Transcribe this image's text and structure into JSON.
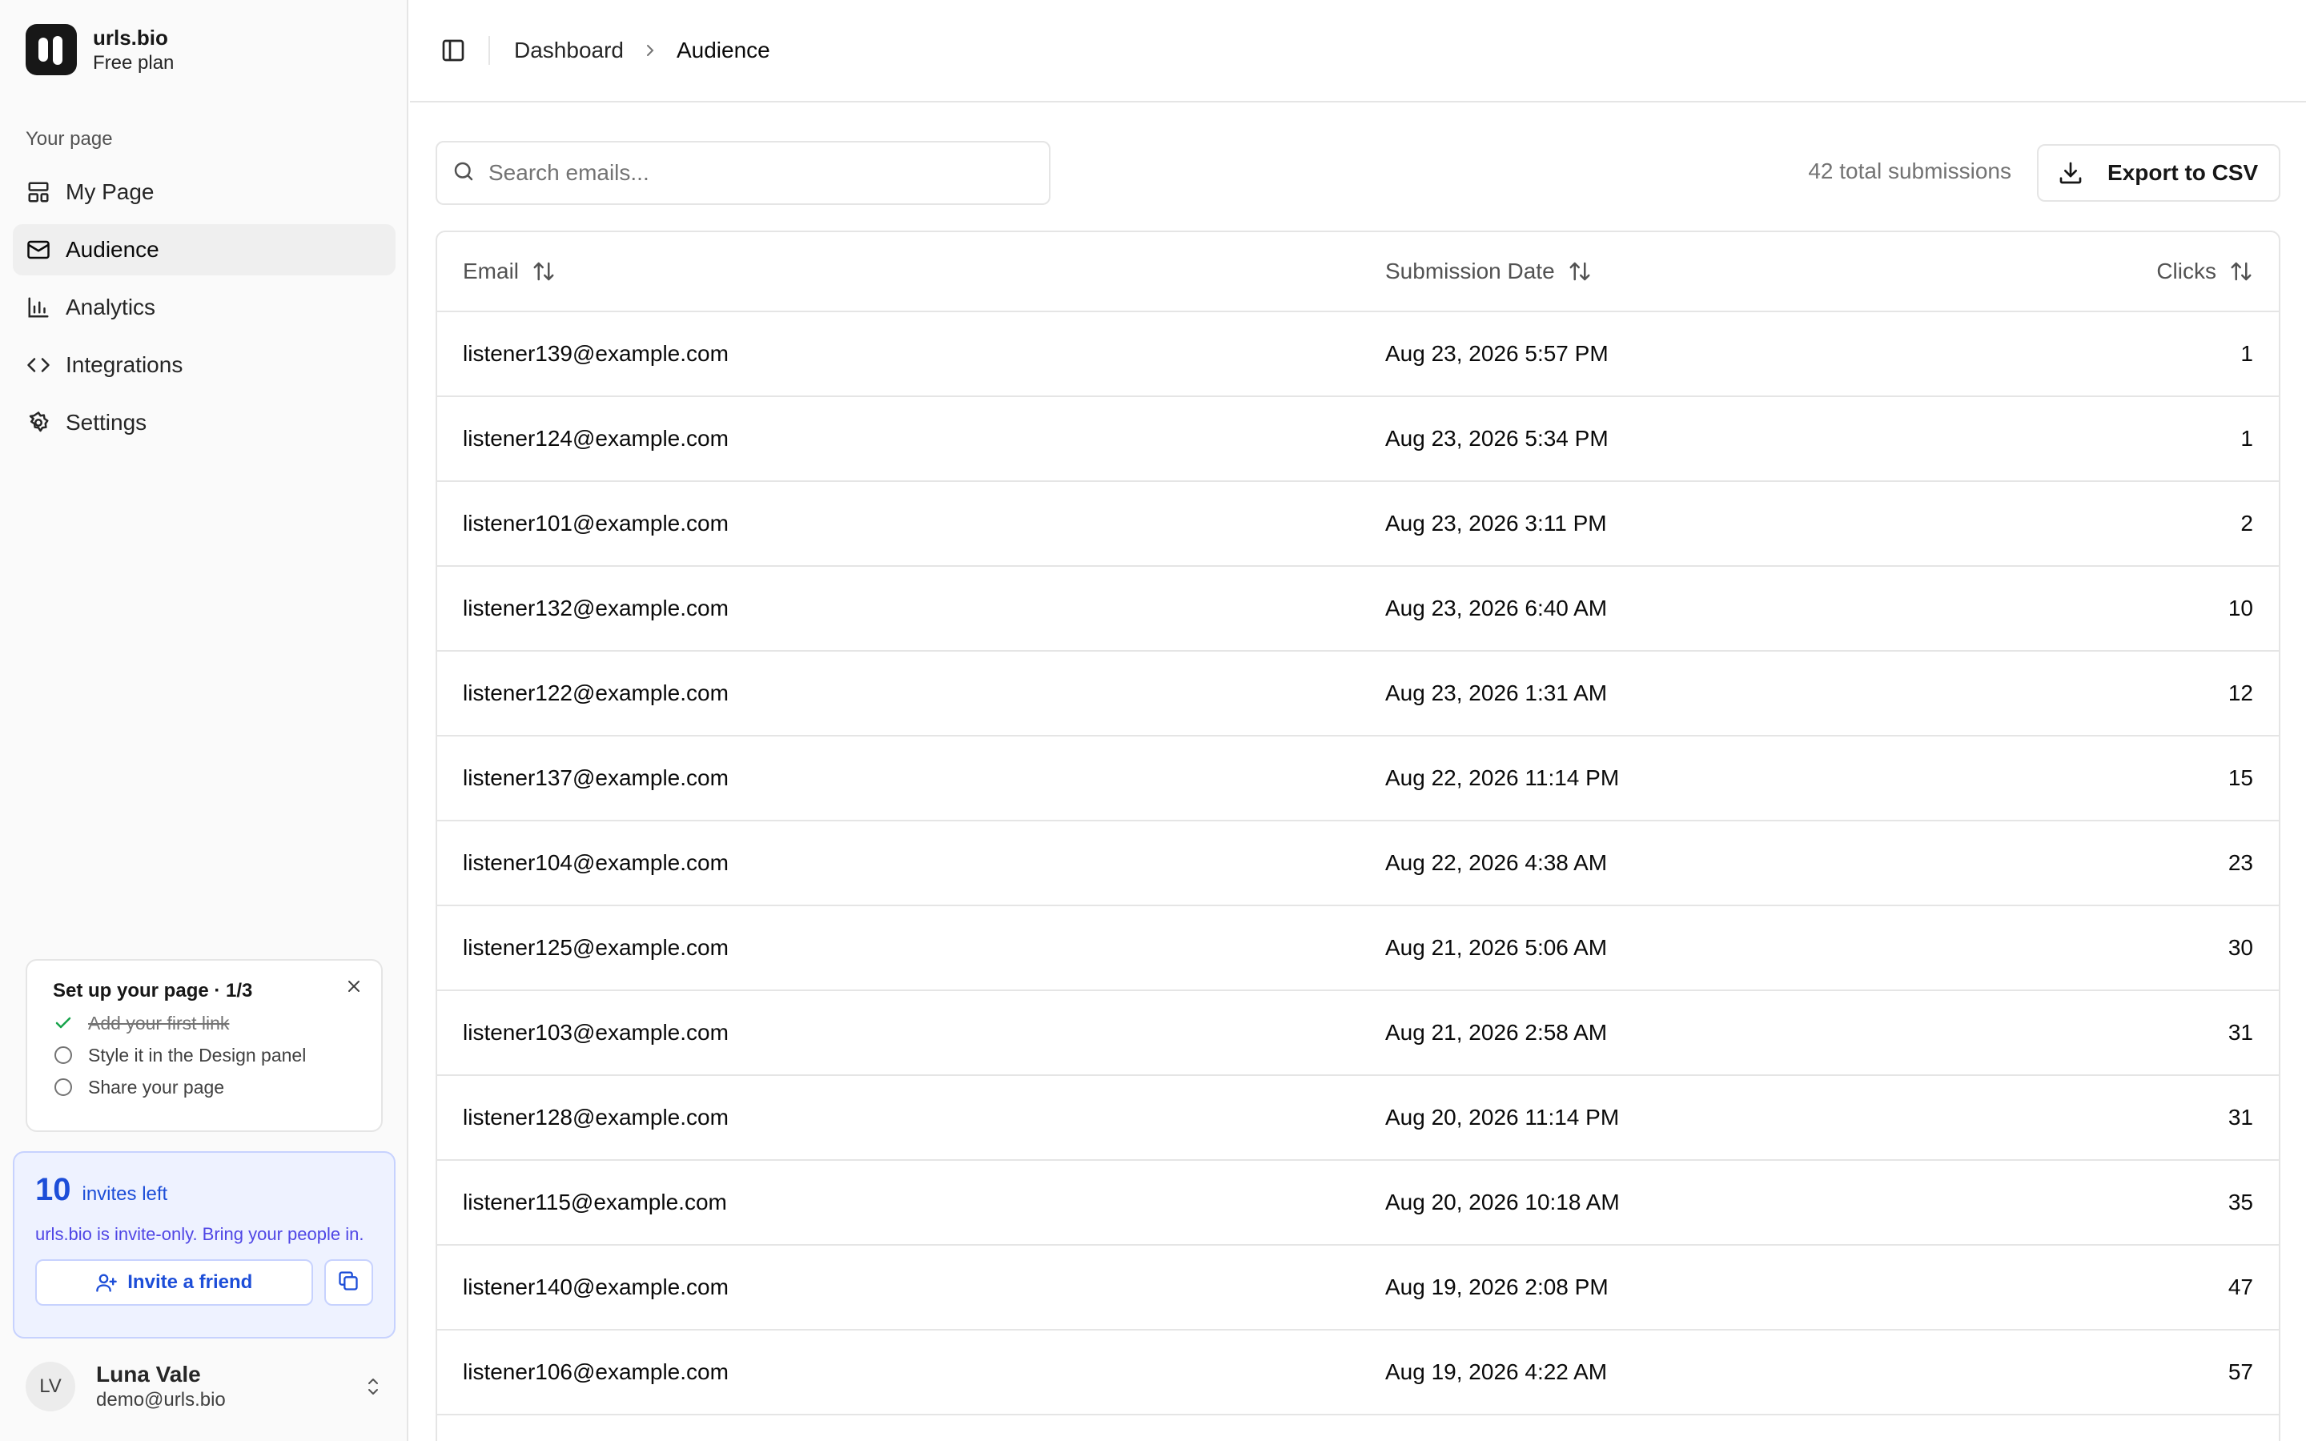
{
  "brand": {
    "name": "urls.bio",
    "plan": "Free plan"
  },
  "sidebar": {
    "section_label": "Your page",
    "items": [
      {
        "label": "My Page",
        "icon": "layout-icon"
      },
      {
        "label": "Audience",
        "icon": "mail-icon",
        "active": true
      },
      {
        "label": "Analytics",
        "icon": "bar-chart-icon"
      },
      {
        "label": "Integrations",
        "icon": "code-icon"
      },
      {
        "label": "Settings",
        "icon": "gear-icon"
      }
    ]
  },
  "setup": {
    "title": "Set up your page · 1/3",
    "items": [
      {
        "label": "Add your first link",
        "done": true
      },
      {
        "label": "Style it in the Design panel",
        "done": false
      },
      {
        "label": "Share your page",
        "done": false
      }
    ]
  },
  "invites": {
    "count": "10",
    "left_label": "invites left",
    "description": "urls.bio is invite-only. Bring your people in.",
    "button_label": "Invite a friend"
  },
  "user": {
    "initials": "LV",
    "name": "Luna Vale",
    "email": "demo@urls.bio"
  },
  "breadcrumb": {
    "parent": "Dashboard",
    "current": "Audience"
  },
  "toolbar": {
    "search_placeholder": "Search emails...",
    "total": "42 total submissions",
    "export_label": "Export to CSV"
  },
  "table": {
    "headers": {
      "email": "Email",
      "date": "Submission Date",
      "clicks": "Clicks"
    },
    "rows": [
      {
        "email": "listener139@example.com",
        "date": "Aug 23, 2026 5:57 PM",
        "clicks": "1"
      },
      {
        "email": "listener124@example.com",
        "date": "Aug 23, 2026 5:34 PM",
        "clicks": "1"
      },
      {
        "email": "listener101@example.com",
        "date": "Aug 23, 2026 3:11 PM",
        "clicks": "2"
      },
      {
        "email": "listener132@example.com",
        "date": "Aug 23, 2026 6:40 AM",
        "clicks": "10"
      },
      {
        "email": "listener122@example.com",
        "date": "Aug 23, 2026 1:31 AM",
        "clicks": "12"
      },
      {
        "email": "listener137@example.com",
        "date": "Aug 22, 2026 11:14 PM",
        "clicks": "15"
      },
      {
        "email": "listener104@example.com",
        "date": "Aug 22, 2026 4:38 AM",
        "clicks": "23"
      },
      {
        "email": "listener125@example.com",
        "date": "Aug 21, 2026 5:06 AM",
        "clicks": "30"
      },
      {
        "email": "listener103@example.com",
        "date": "Aug 21, 2026 2:58 AM",
        "clicks": "31"
      },
      {
        "email": "listener128@example.com",
        "date": "Aug 20, 2026 11:14 PM",
        "clicks": "31"
      },
      {
        "email": "listener115@example.com",
        "date": "Aug 20, 2026 10:18 AM",
        "clicks": "35"
      },
      {
        "email": "listener140@example.com",
        "date": "Aug 19, 2026 2:08 PM",
        "clicks": "47"
      },
      {
        "email": "listener106@example.com",
        "date": "Aug 19, 2026 4:22 AM",
        "clicks": "57"
      }
    ]
  }
}
